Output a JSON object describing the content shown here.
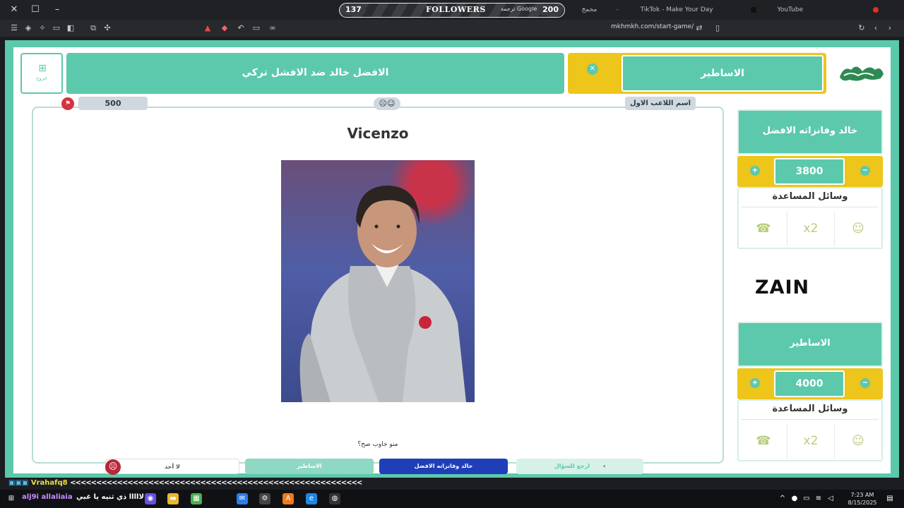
{
  "titlebar": {
    "followers_label": "FOLLOWERS",
    "followers_current": "137",
    "followers_goal": "200",
    "google_translate": "ترجمة Google",
    "tabs": [
      {
        "label": "مخمخ"
      },
      {
        "label": "TikTok - Make Your Day"
      },
      {
        "label": "YouTube"
      }
    ]
  },
  "addressbar": {
    "url": "mkhmkh.com/start-game/"
  },
  "game": {
    "home_label": "خروج",
    "title": "الافضل خالد ضد الافشل تركي",
    "current_team": "الاساطير",
    "points": "500",
    "player_label": "اسم اللاعب الاول",
    "answer": "Vicenzo",
    "who_answered": "منو جاوب صح؟",
    "buttons": {
      "none": "لا أحد",
      "team_legends": "الاساطير",
      "team_khaled": "خالد وفانزاته الافضل",
      "back": "ارجع للسؤال"
    }
  },
  "teams": [
    {
      "name": "خالد وفانزاته الافضل",
      "score": "3800",
      "aids_label": "وسائل المساعدة"
    },
    {
      "name": "الاساطير",
      "score": "4000",
      "aids_label": "وسائل المساعدة"
    }
  ],
  "sponsor": "ZAIN",
  "chat": {
    "username": "Vrahafq8",
    "message": "<<<<<<<<<<<<<<<<<<<<<<<<<<<<<<<<<<<<<<<<<<<<<<<<<<<<<<<<"
  },
  "taskbar": {
    "user": "alj9i allaliaia",
    "message": "لااااا ذي ثنيه يا غبي",
    "time": "7:23 AM",
    "date": "8/15/2025"
  },
  "colors": {
    "teal": "#5cc9ac",
    "yellow": "#eec51a",
    "blue": "#1f3fb8",
    "red": "#d8323b"
  }
}
